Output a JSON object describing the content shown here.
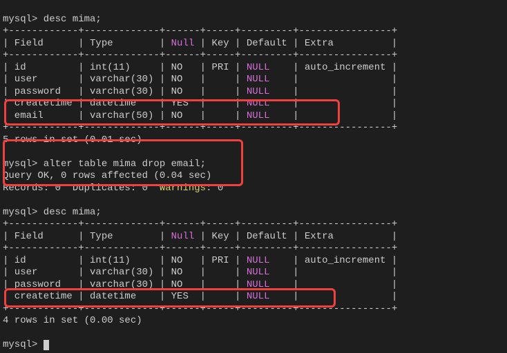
{
  "prompt1": "mysql> desc mima;",
  "tb_sep": "+------------+-------------+------+-----+---------+----------------+",
  "hdr_l": "| Field      | Type        | ",
  "hdr_null": "Null",
  "hdr_r": " | Key | Default | Extra          |",
  "row_id_l": "| id         | int(11)     | NO   | PRI | ",
  "row_id_n": "NULL",
  "row_id_r": "    | auto_increment |",
  "row_user_l": "| user       | varchar(30) | NO   |     | ",
  "row_user_n": "NULL",
  "row_user_r": "    |                |",
  "row_pass_l": "| password   | varchar(30) | NO   |     | ",
  "row_pass_n": "NULL",
  "row_pass_r": "    |                |",
  "row_ct_l": "| createtime | datetime    | YES  |     | ",
  "row_ct_n": "NULL",
  "row_ct_r": "    |                |",
  "row_em_l": "| email      | varchar(50) | NO   |     | ",
  "row_em_n": "NULL",
  "row_em_r": "    |                |",
  "rows5": "5 rows in set (0.01 sec)",
  "prompt2": "mysql> alter table mima drop email;",
  "query_ok": "Query OK, 0 rows affected (0.04 sec)",
  "records_l": "Records: 0  Duplicates: 0  ",
  "warnings_lbl": "Warnings",
  "records_r": ": 0",
  "prompt3": "mysql> desc mima;",
  "rows4": "4 rows in set (0.00 sec)",
  "prompt_end": "mysql> "
}
